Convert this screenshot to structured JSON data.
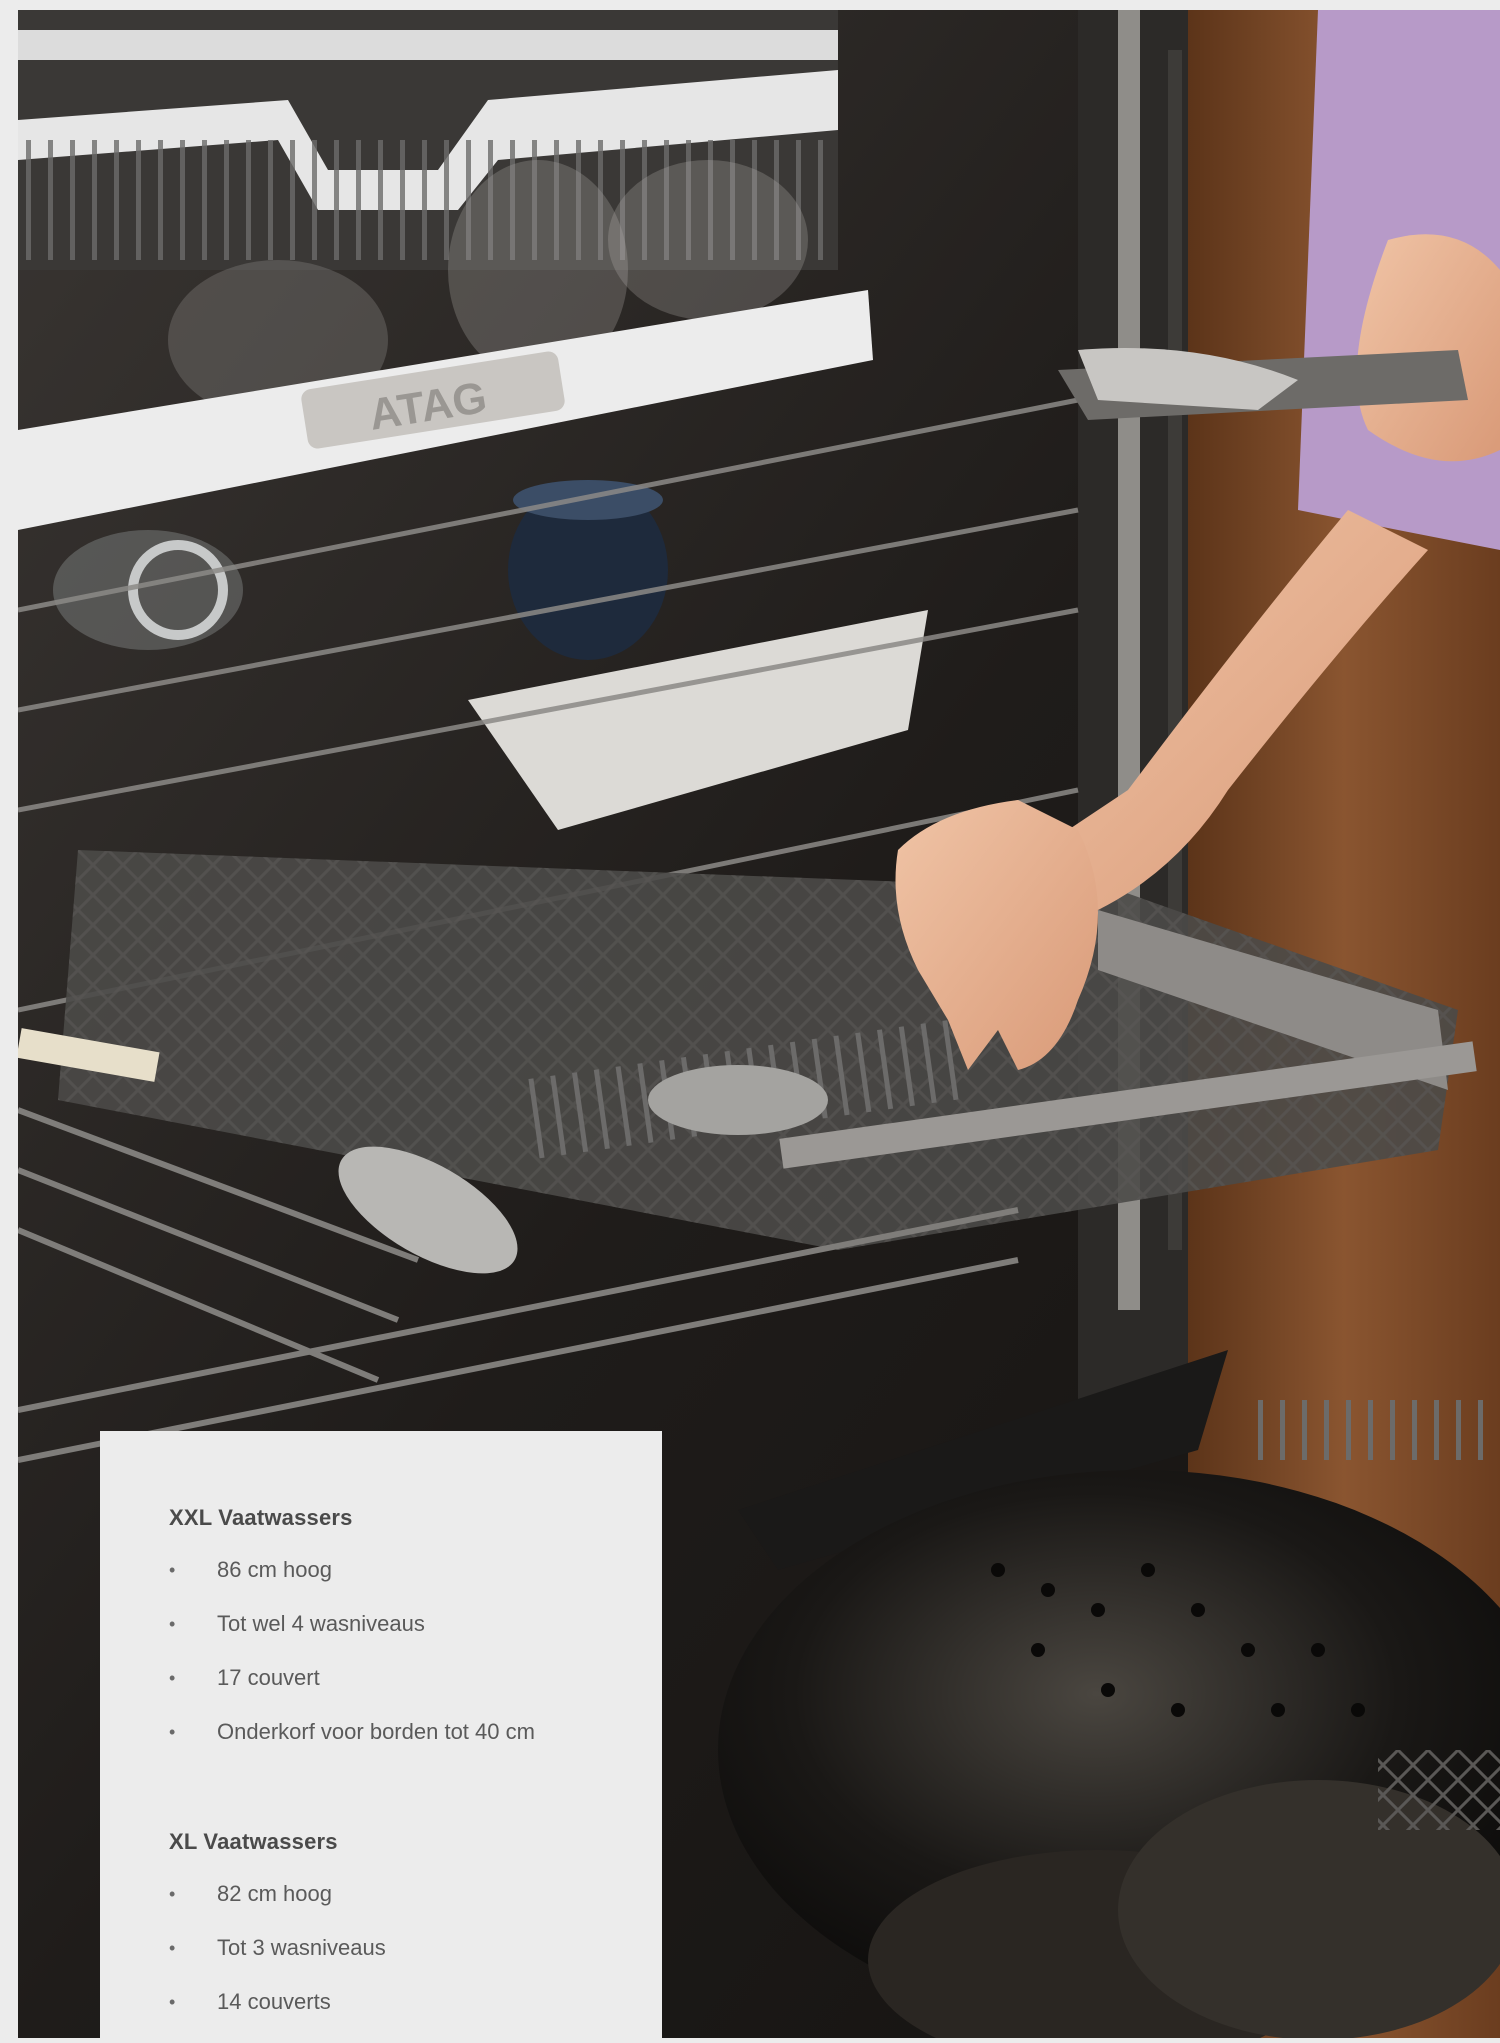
{
  "photo": {
    "brand_badge": "ATAG"
  },
  "sections": [
    {
      "title": "XXL Vaatwassers",
      "items": [
        "86 cm hoog",
        "Tot wel 4 wasniveaus",
        "17 couvert",
        "Onderkorf voor borden tot 40 cm"
      ]
    },
    {
      "title": "XL Vaatwassers",
      "items": [
        "82 cm hoog",
        "Tot 3 wasniveaus",
        "14 couverts"
      ]
    }
  ],
  "bullet_glyph": "•",
  "colors": {
    "panel_background": "#ececec",
    "cabinet_wood": "#7a4a2a",
    "sleeve_lilac": "#b79ac8"
  }
}
